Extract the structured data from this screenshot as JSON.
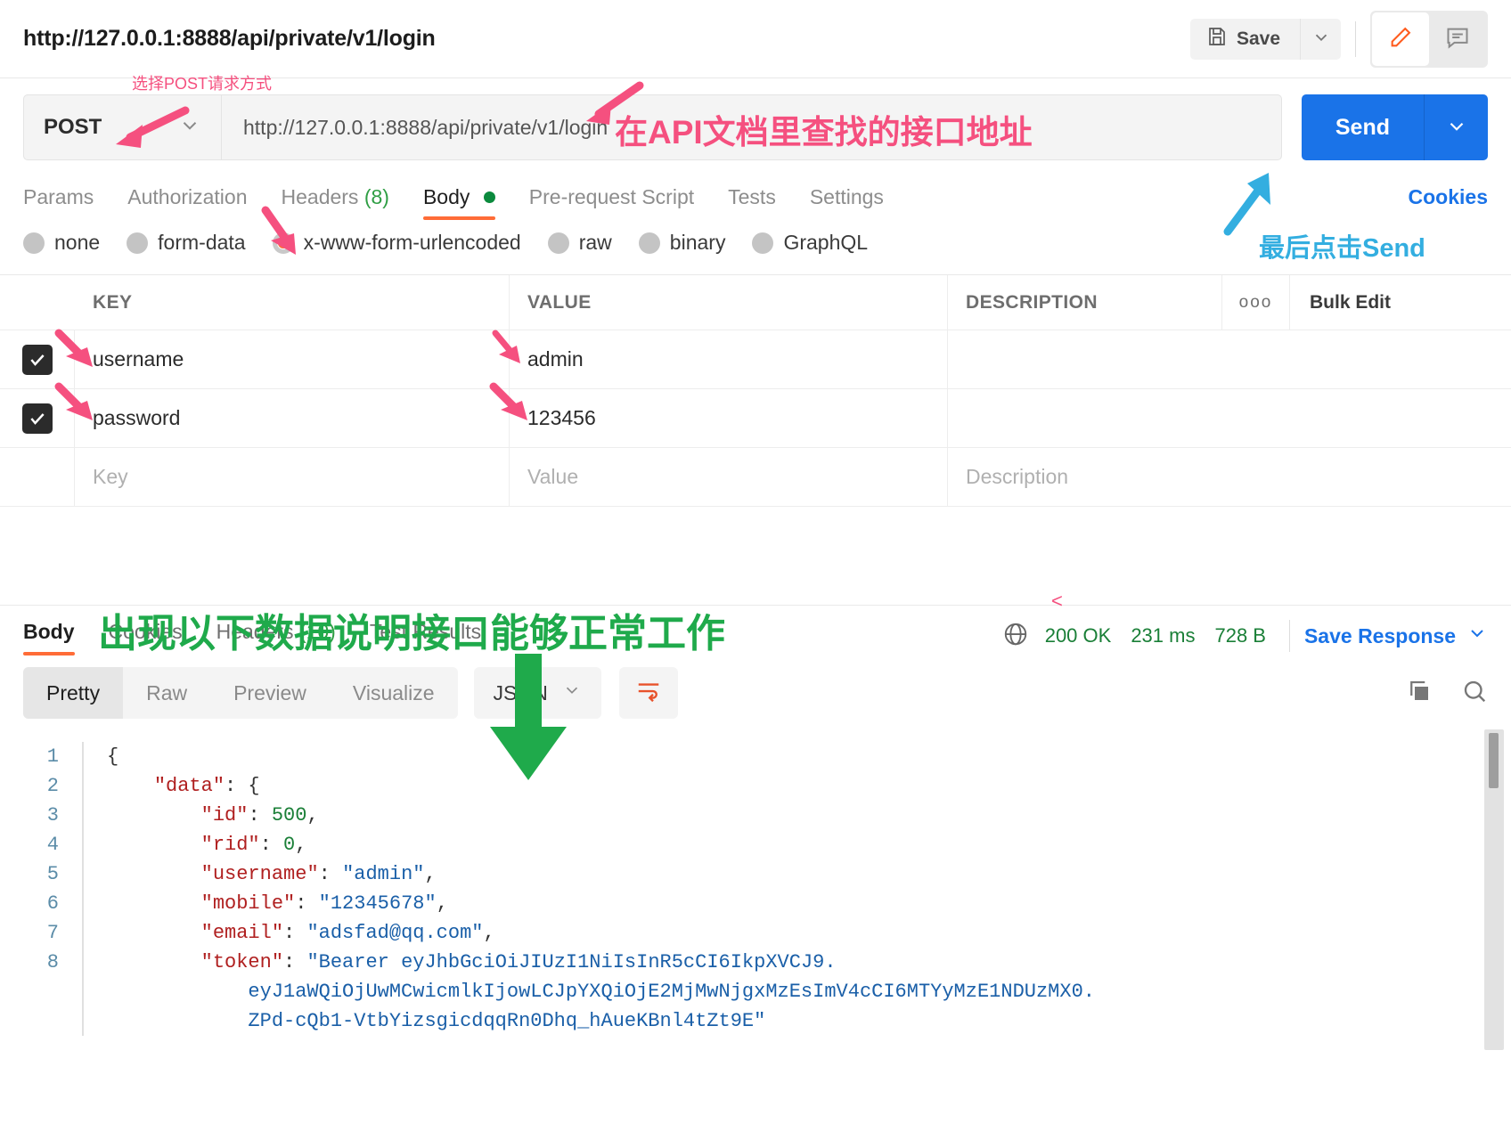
{
  "header": {
    "request_title": "http://127.0.0.1:8888/api/private/v1/login",
    "save_label": "Save",
    "save_icon": "floppy-disk-icon",
    "save_caret_icon": "chevron-down-icon",
    "edit_icon": "pencil-icon",
    "comment_icon": "comment-icon"
  },
  "url_bar": {
    "method": "POST",
    "method_caret_icon": "chevron-down-icon",
    "url": "http://127.0.0.1:8888/api/private/v1/login",
    "send_label": "Send",
    "send_caret_icon": "chevron-down-icon"
  },
  "request_tabs": {
    "items": [
      {
        "label": "Params",
        "count": "",
        "active": false
      },
      {
        "label": "Authorization",
        "count": "",
        "active": false
      },
      {
        "label": "Headers",
        "count": "(8)",
        "active": false
      },
      {
        "label": "Body",
        "count": "",
        "active": true,
        "dot": true
      },
      {
        "label": "Pre-request Script",
        "count": "",
        "active": false
      },
      {
        "label": "Tests",
        "count": "",
        "active": false
      },
      {
        "label": "Settings",
        "count": "",
        "active": false
      }
    ],
    "cookies_link": "Cookies"
  },
  "body_types": [
    {
      "label": "none",
      "selected": false
    },
    {
      "label": "form-data",
      "selected": false
    },
    {
      "label": "x-www-form-urlencoded",
      "selected": true
    },
    {
      "label": "raw",
      "selected": false
    },
    {
      "label": "binary",
      "selected": false
    },
    {
      "label": "GraphQL",
      "selected": false
    }
  ],
  "kv_table": {
    "headers": {
      "key": "KEY",
      "value": "VALUE",
      "description": "DESCRIPTION"
    },
    "options_icon": "more-options-icon",
    "bulk_edit_label": "Bulk Edit",
    "rows": [
      {
        "checked": true,
        "key": "username",
        "value": "admin",
        "description": ""
      },
      {
        "checked": true,
        "key": "password",
        "value": "123456",
        "description": ""
      }
    ],
    "new_row": {
      "key": "Key",
      "value": "Value",
      "description": "Description"
    }
  },
  "response": {
    "tabs": [
      {
        "label": "Body",
        "count": "",
        "active": true
      },
      {
        "label": "Cookies",
        "count": "",
        "active": false
      },
      {
        "label": "Headers",
        "count": "(10)",
        "active": false
      },
      {
        "label": "Test Results",
        "count": "",
        "active": false
      }
    ],
    "globe_icon": "globe-icon",
    "status": "200 OK",
    "time": "231 ms",
    "size": "728 B",
    "save_response_label": "Save Response",
    "save_response_caret_icon": "chevron-down-icon",
    "view_modes": [
      {
        "label": "Pretty",
        "active": true
      },
      {
        "label": "Raw",
        "active": false
      },
      {
        "label": "Preview",
        "active": false
      },
      {
        "label": "Visualize",
        "active": false
      }
    ],
    "format": "JSON",
    "format_caret_icon": "chevron-down-icon",
    "wrap_icon": "word-wrap-icon",
    "copy_icon": "copy-icon",
    "search_icon": "search-icon"
  },
  "code": {
    "lines": [
      {
        "n": "1",
        "segments": [
          {
            "t": "{",
            "c": "punc"
          }
        ]
      },
      {
        "n": "2",
        "segments": [
          {
            "t": "    ",
            "c": "punc"
          },
          {
            "t": "\"data\"",
            "c": "key"
          },
          {
            "t": ": {",
            "c": "punc"
          }
        ]
      },
      {
        "n": "3",
        "segments": [
          {
            "t": "        ",
            "c": "punc"
          },
          {
            "t": "\"id\"",
            "c": "key"
          },
          {
            "t": ": ",
            "c": "punc"
          },
          {
            "t": "500",
            "c": "num"
          },
          {
            "t": ",",
            "c": "punc"
          }
        ]
      },
      {
        "n": "4",
        "segments": [
          {
            "t": "        ",
            "c": "punc"
          },
          {
            "t": "\"rid\"",
            "c": "key"
          },
          {
            "t": ": ",
            "c": "punc"
          },
          {
            "t": "0",
            "c": "num"
          },
          {
            "t": ",",
            "c": "punc"
          }
        ]
      },
      {
        "n": "5",
        "segments": [
          {
            "t": "        ",
            "c": "punc"
          },
          {
            "t": "\"username\"",
            "c": "key"
          },
          {
            "t": ": ",
            "c": "punc"
          },
          {
            "t": "\"admin\"",
            "c": "str"
          },
          {
            "t": ",",
            "c": "punc"
          }
        ]
      },
      {
        "n": "6",
        "segments": [
          {
            "t": "        ",
            "c": "punc"
          },
          {
            "t": "\"mobile\"",
            "c": "key"
          },
          {
            "t": ": ",
            "c": "punc"
          },
          {
            "t": "\"12345678\"",
            "c": "str"
          },
          {
            "t": ",",
            "c": "punc"
          }
        ]
      },
      {
        "n": "7",
        "segments": [
          {
            "t": "        ",
            "c": "punc"
          },
          {
            "t": "\"email\"",
            "c": "key"
          },
          {
            "t": ": ",
            "c": "punc"
          },
          {
            "t": "\"adsfad@qq.com\"",
            "c": "str"
          },
          {
            "t": ",",
            "c": "punc"
          }
        ]
      },
      {
        "n": "8",
        "segments": [
          {
            "t": "        ",
            "c": "punc"
          },
          {
            "t": "\"token\"",
            "c": "key"
          },
          {
            "t": ": ",
            "c": "punc"
          },
          {
            "t": "\"Bearer eyJhbGciOiJIUzI1NiIsInR5cCI6IkpXVCJ9.",
            "c": "str"
          }
        ]
      },
      {
        "n": "",
        "segments": [
          {
            "t": "            eyJ1aWQiOjUwMCwicmlkIjowLCJpYXQiOjE2MjMwNjgxMzEsImV4cCI6MTYyMzE1NDUzMX0.",
            "c": "str"
          }
        ]
      },
      {
        "n": "",
        "segments": [
          {
            "t": "            ZPd-cQb1-VtbYizsgicdqqRn0Dhq_hAueKBnl4tZt9E\"",
            "c": "str"
          }
        ]
      }
    ]
  },
  "annotations": {
    "method_note": "选择POST请求方式",
    "url_note": "在API文档里查找的接口地址",
    "send_note": "最后点击Send",
    "response_note": "出现以下数据说明接口能够正常工作"
  }
}
